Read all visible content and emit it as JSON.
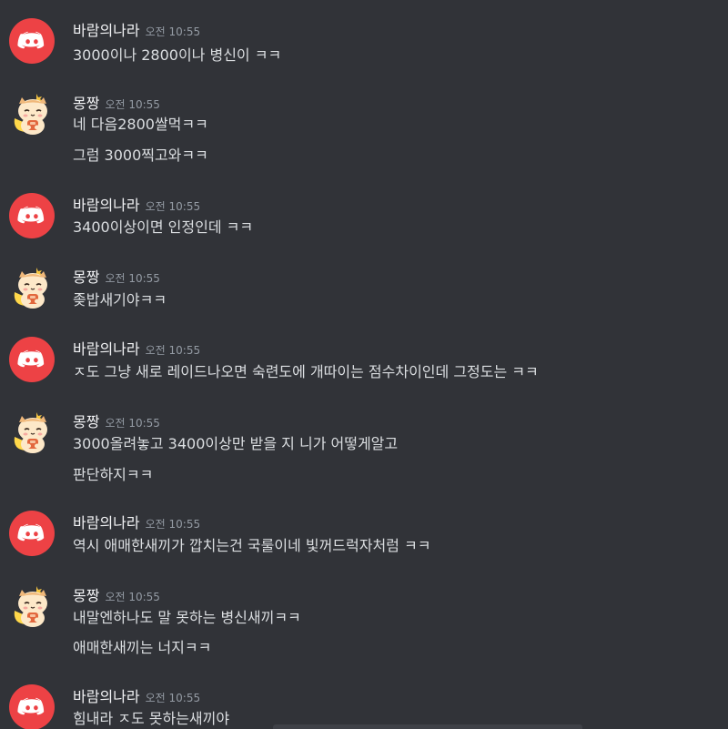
{
  "colors": {
    "background": "#313338",
    "discord_red": "#ed4245",
    "username": "#f2f3f5",
    "timestamp": "#949ba4",
    "message_text": "#dbdee1"
  },
  "messages": [
    {
      "author": "바람의나라",
      "avatar": "discord-logo-icon",
      "time": "오전 10:55",
      "lines": [
        "3000이나 2800이나 병신이 ㅋㅋ"
      ]
    },
    {
      "author": "몽짱",
      "avatar": "cat-avatar-icon",
      "time": "오전 10:55",
      "lines": [
        "네 다음2800쌀먹ㅋㅋ",
        "그럼 3000찍고와ㅋㅋ"
      ]
    },
    {
      "author": "바람의나라",
      "avatar": "discord-logo-icon",
      "time": "오전 10:55",
      "lines": [
        "3400이상이면 인정인데 ㅋㅋ"
      ]
    },
    {
      "author": "몽짱",
      "avatar": "cat-avatar-icon",
      "time": "오전 10:55",
      "lines": [
        "좆밥새기야ㅋㅋ"
      ]
    },
    {
      "author": "바람의나라",
      "avatar": "discord-logo-icon",
      "time": "오전 10:55",
      "lines": [
        "ㅈ도 그냥 새로 레이드나오면 숙련도에 개따이는 점수차이인데 그정도는 ㅋㅋ"
      ]
    },
    {
      "author": "몽짱",
      "avatar": "cat-avatar-icon",
      "time": "오전 10:55",
      "lines": [
        "3000올려놓고 3400이상만 받을 지 니가 어떻게알고",
        "판단하지ㅋㅋ"
      ]
    },
    {
      "author": "바람의나라",
      "avatar": "discord-logo-icon",
      "time": "오전 10:55",
      "lines": [
        "역시 애매한새끼가 깝치는건 국룰이네 빛꺼드럭자처럼 ㅋㅋ"
      ]
    },
    {
      "author": "몽짱",
      "avatar": "cat-avatar-icon",
      "time": "오전 10:55",
      "lines": [
        "내말엔하나도 말 못하는 병신새끼ㅋㅋ",
        "애매한새끼는 너지ㅋㅋ"
      ]
    },
    {
      "author": "바람의나라",
      "avatar": "discord-logo-icon",
      "time": "오전 10:55",
      "lines": [
        "힘내라 ㅈ도 못하는새끼야"
      ]
    }
  ]
}
